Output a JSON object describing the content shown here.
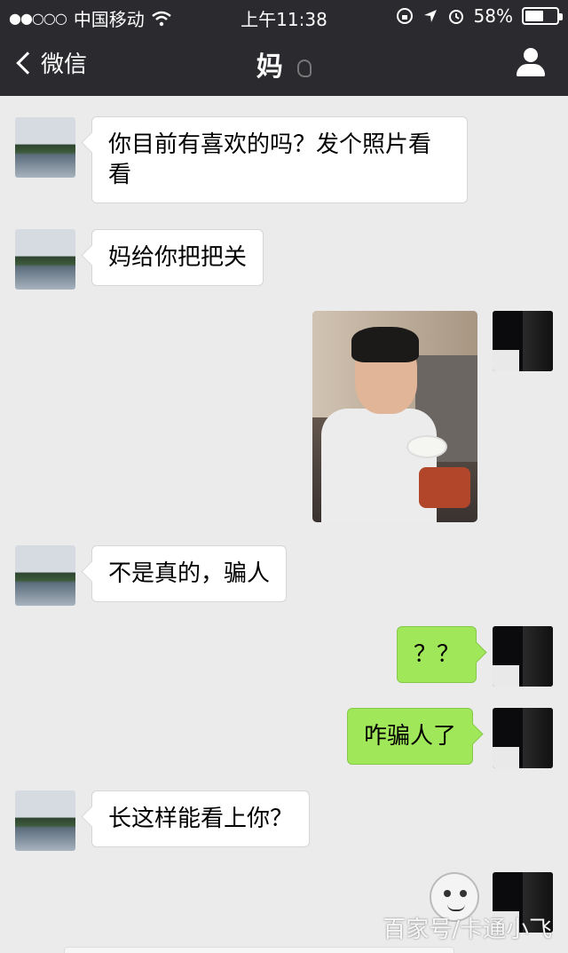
{
  "status_bar": {
    "carrier": "中国移动",
    "signal_dots": "●●○○○",
    "time": "上午11:38",
    "battery": "58%",
    "battery_level": 0.58
  },
  "nav": {
    "back_label": "微信",
    "title": "妈"
  },
  "messages": [
    {
      "from": "mom",
      "type": "text",
      "text": "你目前有喜欢的吗？发个照片看看"
    },
    {
      "from": "mom",
      "type": "text",
      "text": "妈给你把把关"
    },
    {
      "from": "me",
      "type": "image"
    },
    {
      "from": "mom",
      "type": "text",
      "text": "不是真的，骗人"
    },
    {
      "from": "me",
      "type": "text",
      "text": "？？"
    },
    {
      "from": "me",
      "type": "text",
      "text": "咋骗人了"
    },
    {
      "from": "mom",
      "type": "text",
      "text": "长这样能看上你？"
    },
    {
      "from": "me",
      "type": "sticker"
    }
  ],
  "watermark": "百家号/卡通小飞",
  "colors": {
    "topbar": "#2b2b2f",
    "chat_bg": "#ebebeb",
    "outgoing_bubble": "#a0e75a",
    "incoming_bubble": "#ffffff"
  }
}
